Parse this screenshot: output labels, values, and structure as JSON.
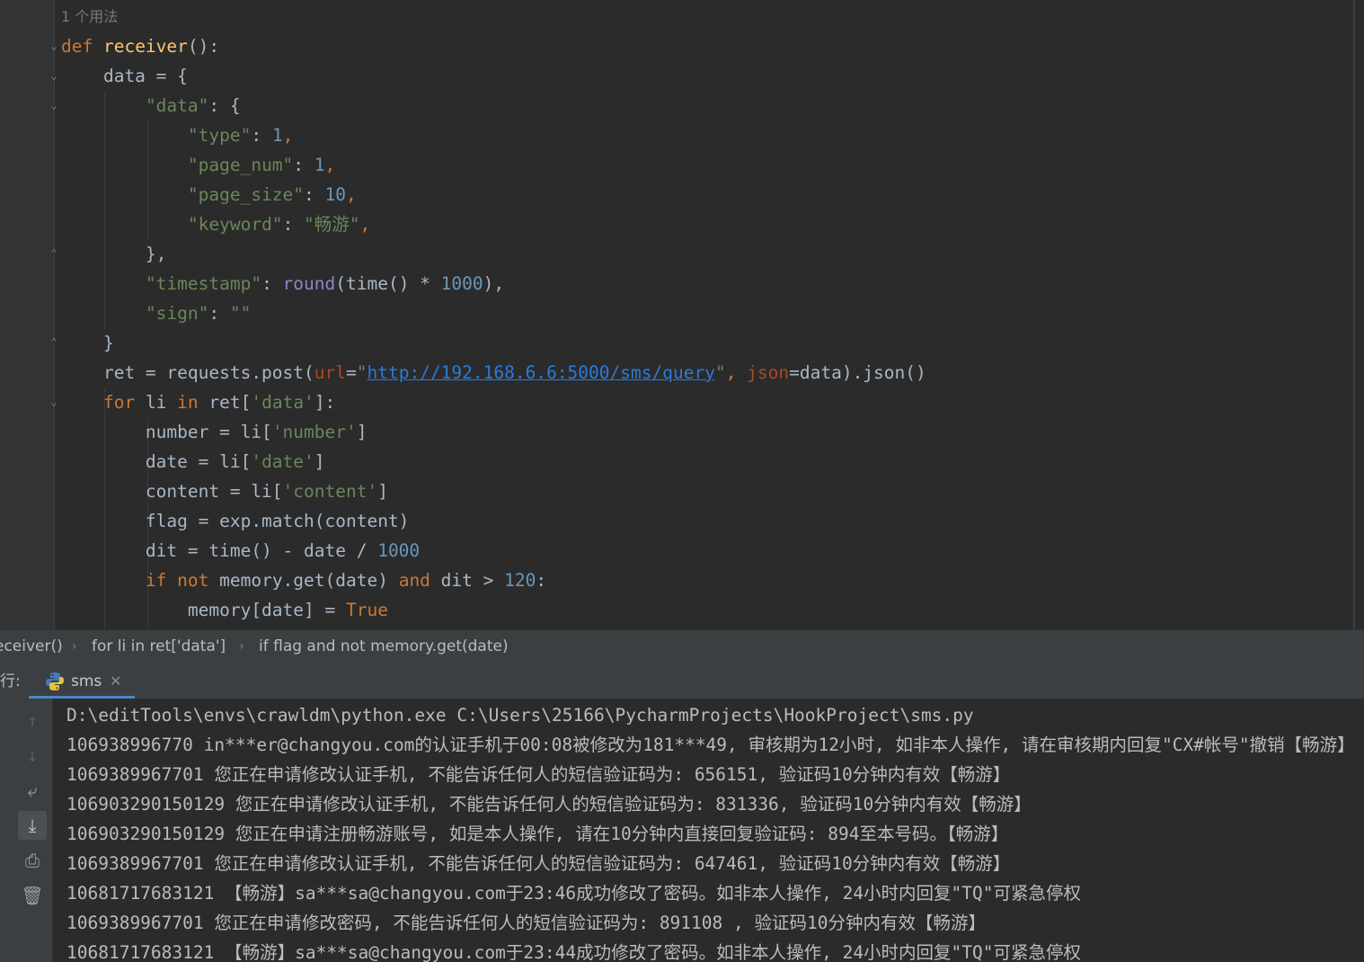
{
  "editor": {
    "usage_hint": "1 个用法",
    "lines": [
      [
        {
          "t": "def ",
          "c": "kw"
        },
        {
          "t": "receiver",
          "c": "fn"
        },
        {
          "t": "():",
          "c": "op"
        }
      ],
      [
        {
          "t": "    data = {",
          "c": "op"
        }
      ],
      [
        {
          "t": "        ",
          "c": "op"
        },
        {
          "t": "\"data\"",
          "c": "str"
        },
        {
          "t": ": {",
          "c": "op"
        }
      ],
      [
        {
          "t": "            ",
          "c": "op"
        },
        {
          "t": "\"type\"",
          "c": "str"
        },
        {
          "t": ": ",
          "c": "op"
        },
        {
          "t": "1",
          "c": "num"
        },
        {
          "t": ",",
          "c": "kw"
        }
      ],
      [
        {
          "t": "            ",
          "c": "op"
        },
        {
          "t": "\"page_num\"",
          "c": "str"
        },
        {
          "t": ": ",
          "c": "op"
        },
        {
          "t": "1",
          "c": "num"
        },
        {
          "t": ",",
          "c": "kw"
        }
      ],
      [
        {
          "t": "            ",
          "c": "op"
        },
        {
          "t": "\"page_size\"",
          "c": "str"
        },
        {
          "t": ": ",
          "c": "op"
        },
        {
          "t": "10",
          "c": "num"
        },
        {
          "t": ",",
          "c": "kw"
        }
      ],
      [
        {
          "t": "            ",
          "c": "op"
        },
        {
          "t": "\"keyword\"",
          "c": "str"
        },
        {
          "t": ": ",
          "c": "op"
        },
        {
          "t": "\"畅游\"",
          "c": "str"
        },
        {
          "t": ",",
          "c": "kw"
        }
      ],
      [
        {
          "t": "        },",
          "c": "op"
        }
      ],
      [
        {
          "t": "        ",
          "c": "op"
        },
        {
          "t": "\"timestamp\"",
          "c": "str"
        },
        {
          "t": ": ",
          "c": "op"
        },
        {
          "t": "round",
          "c": "builtin"
        },
        {
          "t": "(time() * ",
          "c": "op"
        },
        {
          "t": "1000",
          "c": "num"
        },
        {
          "t": "),",
          "c": "op"
        }
      ],
      [
        {
          "t": "        ",
          "c": "op"
        },
        {
          "t": "\"sign\"",
          "c": "str"
        },
        {
          "t": ": ",
          "c": "op"
        },
        {
          "t": "\"\"",
          "c": "str"
        }
      ],
      [
        {
          "t": "    }",
          "c": "op"
        }
      ],
      [
        {
          "t": "    ret = requests.post(",
          "c": "op"
        },
        {
          "t": "url",
          "c": "param"
        },
        {
          "t": "=",
          "c": "op"
        },
        {
          "t": "\"",
          "c": "str"
        },
        {
          "t": "http://192.168.6.6:5000/sms/query",
          "c": "link"
        },
        {
          "t": "\"",
          "c": "str"
        },
        {
          "t": ", ",
          "c": "kw"
        },
        {
          "t": "json",
          "c": "param"
        },
        {
          "t": "=data).json()",
          "c": "op"
        }
      ],
      [
        {
          "t": "    ",
          "c": "op"
        },
        {
          "t": "for",
          "c": "kw"
        },
        {
          "t": " li ",
          "c": "op"
        },
        {
          "t": "in",
          "c": "kw"
        },
        {
          "t": " ret[",
          "c": "op"
        },
        {
          "t": "'data'",
          "c": "str"
        },
        {
          "t": "]:",
          "c": "op"
        }
      ],
      [
        {
          "t": "        number = li[",
          "c": "op"
        },
        {
          "t": "'number'",
          "c": "str"
        },
        {
          "t": "]",
          "c": "op"
        }
      ],
      [
        {
          "t": "        date = li[",
          "c": "op"
        },
        {
          "t": "'date'",
          "c": "str"
        },
        {
          "t": "]",
          "c": "op"
        }
      ],
      [
        {
          "t": "        content = li[",
          "c": "op"
        },
        {
          "t": "'content'",
          "c": "str"
        },
        {
          "t": "]",
          "c": "op"
        }
      ],
      [
        {
          "t": "        flag = exp.match(content)",
          "c": "op"
        }
      ],
      [
        {
          "t": "        dit = time() - date / ",
          "c": "op"
        },
        {
          "t": "1000",
          "c": "num"
        }
      ],
      [
        {
          "t": "        ",
          "c": "op"
        },
        {
          "t": "if not",
          "c": "kw"
        },
        {
          "t": " memory.get(date) ",
          "c": "op"
        },
        {
          "t": "and",
          "c": "kw"
        },
        {
          "t": " dit > ",
          "c": "op"
        },
        {
          "t": "120",
          "c": "num"
        },
        {
          "t": ":",
          "c": "op"
        }
      ],
      [
        {
          "t": "            memory[date] = ",
          "c": "op"
        },
        {
          "t": "True",
          "c": "kw"
        }
      ]
    ]
  },
  "breadcrumb": {
    "items": [
      "eceiver()",
      "for li in ret['data']",
      "if flag and not memory.get(date)"
    ],
    "separator": "›"
  },
  "run_panel": {
    "label": "行:",
    "tab_label": "sms",
    "close_glyph": "✕"
  },
  "console": {
    "tools": [
      {
        "name": "scroll-up-icon",
        "glyph": "↑",
        "dim": true,
        "active": false
      },
      {
        "name": "scroll-down-icon",
        "glyph": "↓",
        "dim": true,
        "active": false
      },
      {
        "name": "soft-wrap-icon",
        "glyph": "⤶",
        "dim": false,
        "active": false
      },
      {
        "name": "scroll-to-end-icon",
        "glyph": "⤓",
        "dim": false,
        "active": true
      },
      {
        "name": "print-icon",
        "glyph": "⎙",
        "dim": false,
        "active": false
      },
      {
        "name": "trash-icon",
        "glyph": "🗑",
        "dim": false,
        "active": false
      }
    ],
    "lines": [
      "D:\\editTools\\envs\\crawldm\\python.exe C:\\Users\\25166\\PycharmProjects\\HookProject\\sms.py",
      "106938996770 in***er@changyou.com的认证手机于00:08被修改为181***49, 审核期为12小时, 如非本人操作, 请在审核期内回复\"CX#帐号\"撤销【畅游】",
      "1069389967701 您正在申请修改认证手机, 不能告诉任何人的短信验证码为: 656151, 验证码10分钟内有效【畅游】",
      "106903290150129 您正在申请修改认证手机, 不能告诉任何人的短信验证码为: 831336, 验证码10分钟内有效【畅游】",
      "106903290150129 您正在申请注册畅游账号, 如是本人操作, 请在10分钟内直接回复验证码: 894至本号码。【畅游】",
      "1069389967701 您正在申请修改认证手机, 不能告诉任何人的短信验证码为: 647461, 验证码10分钟内有效【畅游】",
      "10681717683121 【畅游】sa***sa@changyou.com于23:46成功修改了密码。如非本人操作, 24小时内回复\"TQ\"可紧急停权",
      "1069389967701 您正在申请修改密码, 不能告诉任何人的短信验证码为: 891108 , 验证码10分钟内有效【畅游】",
      "10681717683121 【畅游】sa***sa@changyou.com于23:44成功修改了密码。如非本人操作, 24小时内回复\"TQ\"可紧急停权"
    ]
  },
  "colors": {
    "editor_bg": "#2b2b2b",
    "keyword": "#cc7832",
    "function": "#ffc66d",
    "string": "#6a8759",
    "number": "#6897bb",
    "builtin": "#8888c6",
    "param": "#aa4926",
    "link": "#287bde",
    "default_text": "#a9b7c6"
  }
}
